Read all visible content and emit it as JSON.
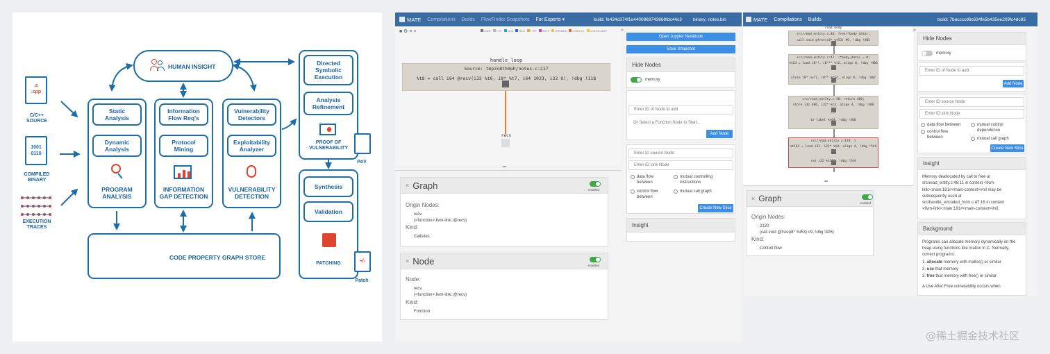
{
  "diagram": {
    "source_cpp_lines": [
      ".c",
      ".cpp"
    ],
    "source_label": [
      "C/C++",
      "SOURCE"
    ],
    "binary_digits": [
      "1001",
      "0110"
    ],
    "binary_label": [
      "COMPILED",
      "BINARY"
    ],
    "traces_label": [
      "EXECUTION",
      "TRACES"
    ],
    "human_insight": "HUMAN INSIGHT",
    "program_analysis": {
      "items": [
        [
          "Static",
          "Analysis"
        ],
        [
          "Dynamic",
          "Analysis"
        ]
      ],
      "title": [
        "PROGRAM",
        "ANALYSIS"
      ]
    },
    "info_gap": {
      "items": [
        [
          "Information",
          "Flow Req's"
        ],
        [
          "Protocol",
          "Mining"
        ]
      ],
      "title": [
        "INFORMATION",
        "GAP DETECTION"
      ]
    },
    "vuln_detection": {
      "items": [
        [
          "Vulnerability",
          "Detectors"
        ],
        [
          "Exploitability",
          "Analyzer"
        ]
      ],
      "title": [
        "VULNERABILITY",
        "DETECTION"
      ]
    },
    "right_top": {
      "items": [
        [
          "Directed",
          "Symbolic",
          "Execution"
        ],
        [
          "Analysis",
          "Refinement"
        ]
      ],
      "title": [
        "PROOF OF",
        "VULNERABILITY"
      ],
      "badge": "PoV"
    },
    "right_bottom": {
      "items": [
        "Synthesis",
        "Validation"
      ],
      "title": "PATCHING",
      "badge_icon": "+/-",
      "badge": "Patch"
    },
    "cpg_store": "CODE PROPERTY GRAPH STORE",
    "colors": {
      "primary": "#1d6ea8",
      "accent": "#e0432f"
    }
  },
  "mate1": {
    "navbar": {
      "logo": "MATE",
      "links": [
        "Compilations",
        "Builds",
        "FlowFinder Snapshots",
        "For Experts ▾"
      ],
      "build": "build: fe434d374f1e4400869743868fdc44c3",
      "binary": "binary: notes.bin"
    },
    "legend": [
      "CODE",
      "CFG",
      "DATA",
      "MEM",
      "TYPE",
      "INSTR",
      "OPERAND",
      "CONTROL",
      "CONTROLDEP"
    ],
    "graph": {
      "node_title": "handle_loop",
      "source": "Source: tmpzn8th0ph/notes.c:217",
      "code": "%t8 = call i64 @recv(i32 %t6, i8* %t7, i64 1023, i32 0), !dbg !118",
      "callee": "recv"
    },
    "divider": "═",
    "graph_panel": {
      "title": "Graph",
      "enabled": "enabled",
      "origin_label": "Origin Nodes:",
      "origin_lines": [
        "recv",
        "(<function>:llvm-link::@recv)"
      ],
      "kind_label": "Kind:",
      "kind_value": "Callsites"
    },
    "node_panel": {
      "title": "Node",
      "enabled": "enabled",
      "node_label": "Node:",
      "node_lines": [
        "recv",
        "(<function>:llvm-link::@recv)"
      ],
      "kind_label": "Kind:",
      "kind_value": "Function"
    },
    "side": {
      "open_jupyter": "Open Jupyter Notebook",
      "save_snapshot": "Save Snapshot",
      "hide_nodes": "Hide Nodes",
      "memory": "memory",
      "node_id_placeholder": "Enter ID of Node to add",
      "function_placeholder": "Or Select a Function Node to Start...",
      "add_node": "Add Node",
      "source_placeholder": "Enter ID source Node",
      "sink_placeholder": "Enter ID sink Node",
      "options": [
        [
          "data flow",
          "between"
        ],
        [
          "control flow",
          "between"
        ],
        [
          "mutual controlling",
          "instructions"
        ],
        [
          "mutual call graph"
        ]
      ],
      "create_slice": "Create New Slice",
      "insight": "Insight"
    }
  },
  "mate2": {
    "navbar": {
      "logo": "MATE",
      "links": [
        "Compilations",
        "Builds"
      ],
      "build": "build: 7baccccd6c634fe5b435ee209fc4dc83"
    },
    "graph_nodes": [
      {
        "title": "read_body",
        "lines": [
          "src/read_entity.c:46: free(*body_data);",
          "call void @free(i8* %t53) #9, !dbg !405"
        ]
      },
      {
        "title": "",
        "lines": [
          "src/read_entity.c:47: (*body_data) = 0;",
          "%t54 = load i8**, i8*** %t2, align 8, !dbg !406",
          "store i8* null, i8** %t54, align 8, !dbg !407"
        ]
      },
      {
        "title": "",
        "lines": [
          "src/read_entity.c:48: return 400;",
          "store i32 400, i32* %t4, align 4, !dbg !408",
          "br label %t64, !dbg !408"
        ]
      },
      {
        "title": "",
        "lines": [
          "src/read_entity.c:174: }",
          "%t162 = load i32, i32* %t4, align 4, !dbg !544",
          "ret i32 %t162, !dbg !544"
        ]
      }
    ],
    "divider": "═",
    "graph_panel": {
      "title": "Graph",
      "enabled": "enabled",
      "origin_label": "Origin Nodes:",
      "origin_lines": [
        "2130",
        "(call void @free(i8* %t53) #9, !dbg !405)"
      ],
      "kind_label": "Kind:",
      "kind_value": "Control flow"
    },
    "side": {
      "hide_nodes": "Hide Nodes",
      "memory": "memory",
      "node_id_placeholder": "Enter ID of Node to add",
      "add_node": "Add Node",
      "source_placeholder": "Enter ID source Node",
      "sink_placeholder": "Enter ID sink Node",
      "options": [
        [
          "data flow between"
        ],
        [
          "control flow",
          "between"
        ],
        [
          "mutual control",
          "dependence"
        ],
        [
          "mutual call graph"
        ]
      ],
      "create_slice": "Create New Slice",
      "insight": "Insight",
      "insight_text": [
        "Memory deallocated by call to free at",
        "src/read_entity.c:46:11 in context <llvm-",
        "link>:main:181#<main-context>#nil may be",
        "subsequently used at",
        "src/handle_encoded_form.c:47:16 in context",
        "<llvm-link>:main:181#<main-context>#nil."
      ],
      "background": "Background",
      "bg_text": [
        "Programs can allocate memory dynamically on the",
        "heap using functions like malloc in C. Normally,",
        "correct programs:"
      ],
      "bg_list": [
        {
          "bold": "allocate",
          "rest": " memory with malloc() or similar"
        },
        {
          "bold": "use",
          "rest": " that memory"
        },
        {
          "bold": "free",
          "rest": " that memory with free() or similar"
        }
      ],
      "bg_tail": "A Use After Free vulnerability occurs when"
    }
  },
  "watermark": "@稀土掘金技术社区"
}
